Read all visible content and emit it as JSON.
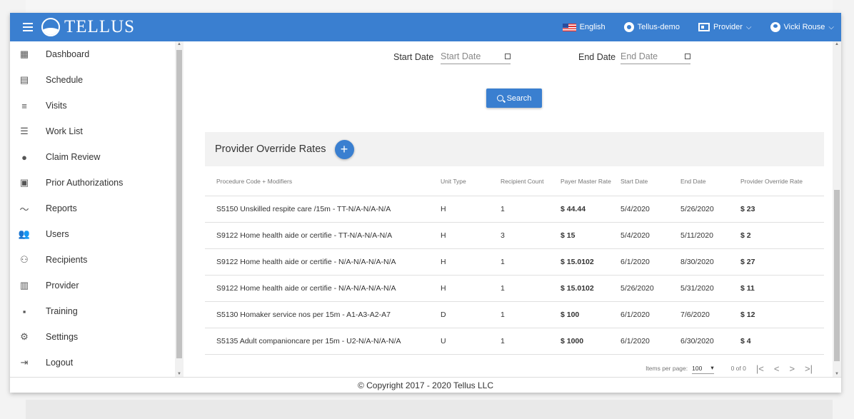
{
  "app": {
    "brand": "TELLUS"
  },
  "topbar": {
    "language": "English",
    "org": "Tellus-demo",
    "role": "Provider",
    "user": "Vicki Rouse",
    "color": "#3a7fd0"
  },
  "sidebar": {
    "items": [
      {
        "label": "Dashboard",
        "icon": "dashboard-icon",
        "glyph": "▦"
      },
      {
        "label": "Schedule",
        "icon": "calendar-icon",
        "glyph": "▤"
      },
      {
        "label": "Visits",
        "icon": "filter-icon",
        "glyph": "≡"
      },
      {
        "label": "Work List",
        "icon": "list-icon",
        "glyph": "☰"
      },
      {
        "label": "Claim Review",
        "icon": "alert-icon",
        "glyph": "●"
      },
      {
        "label": "Prior Authorizations",
        "icon": "event-icon",
        "glyph": "▣"
      },
      {
        "label": "Reports",
        "icon": "trend-icon",
        "glyph": "〜"
      },
      {
        "label": "Users",
        "icon": "people-icon",
        "glyph": "👥"
      },
      {
        "label": "Recipients",
        "icon": "people-outline-icon",
        "glyph": "⚇"
      },
      {
        "label": "Provider",
        "icon": "clipboard-icon",
        "glyph": "▥"
      },
      {
        "label": "Training",
        "icon": "training-icon",
        "glyph": "▪"
      },
      {
        "label": "Settings",
        "icon": "gear-icon",
        "glyph": "⚙"
      },
      {
        "label": "Logout",
        "icon": "logout-icon",
        "glyph": "⇥"
      }
    ]
  },
  "filters": {
    "start_label": "Start Date",
    "start_placeholder": "Start Date",
    "end_label": "End Date",
    "end_placeholder": "End Date",
    "search_label": "Search"
  },
  "rates": {
    "title": "Provider Override Rates",
    "columns": [
      "Procedure Code + Modifiers",
      "Unit Type",
      "Recipient Count",
      "Payer Master Rate",
      "Start Date",
      "End Date",
      "Provider Override Rate"
    ],
    "rows": [
      [
        "S5150 Unskilled respite care /15m - TT-N/A-N/A-N/A",
        "H",
        "1",
        "$ 44.44",
        "5/4/2020",
        "5/26/2020",
        "$ 23"
      ],
      [
        "S9122 Home health aide or certifie - TT-N/A-N/A-N/A",
        "H",
        "3",
        "$ 15",
        "5/4/2020",
        "5/11/2020",
        "$ 2"
      ],
      [
        "S9122 Home health aide or certifie - N/A-N/A-N/A-N/A",
        "H",
        "1",
        "$ 15.0102",
        "6/1/2020",
        "8/30/2020",
        "$ 27"
      ],
      [
        "S9122 Home health aide or certifie - N/A-N/A-N/A-N/A",
        "H",
        "1",
        "$ 15.0102",
        "5/26/2020",
        "5/31/2020",
        "$ 11"
      ],
      [
        "S5130 Homaker service nos per 15m - A1-A3-A2-A7",
        "D",
        "1",
        "$ 100",
        "6/1/2020",
        "7/6/2020",
        "$ 12"
      ],
      [
        "S5135 Adult companioncare per 15m - U2-N/A-N/A-N/A",
        "U",
        "1",
        "$ 1000",
        "6/1/2020",
        "6/30/2020",
        "$ 4"
      ]
    ]
  },
  "paginator": {
    "items_label": "Items per page:",
    "page_size": "100",
    "range": "0 of 0"
  },
  "footer": {
    "text": "© Copyright 2017 - 2020 Tellus LLC"
  }
}
